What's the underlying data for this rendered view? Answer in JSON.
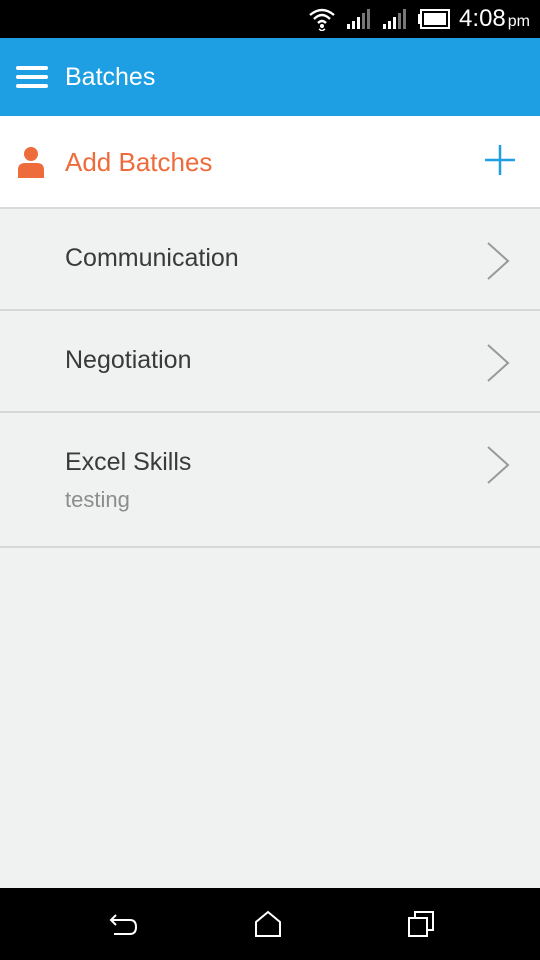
{
  "status_bar": {
    "time": "4:08",
    "ampm": "pm",
    "icons": [
      "wifi-icon",
      "signal-icon",
      "signal-icon",
      "battery-icon"
    ]
  },
  "app_bar": {
    "title": "Batches",
    "menu_icon": "hamburger-menu-icon"
  },
  "add_row": {
    "label": "Add Batches",
    "icon": "person-icon",
    "action_icon": "plus-icon",
    "accent_color": "#ee6b3b",
    "action_color": "#1e9fe3"
  },
  "batches": [
    {
      "title": "Communication",
      "subtitle": ""
    },
    {
      "title": "Negotiation",
      "subtitle": ""
    },
    {
      "title": "Excel Skills",
      "subtitle": "testing"
    }
  ],
  "nav_bar": {
    "buttons": [
      "back-icon",
      "home-icon",
      "recent-apps-icon"
    ]
  },
  "colors": {
    "primary": "#1e9fe3",
    "background": "#f0f1f1",
    "text": "#3a3a3a",
    "subtext": "#8d8d8d"
  }
}
